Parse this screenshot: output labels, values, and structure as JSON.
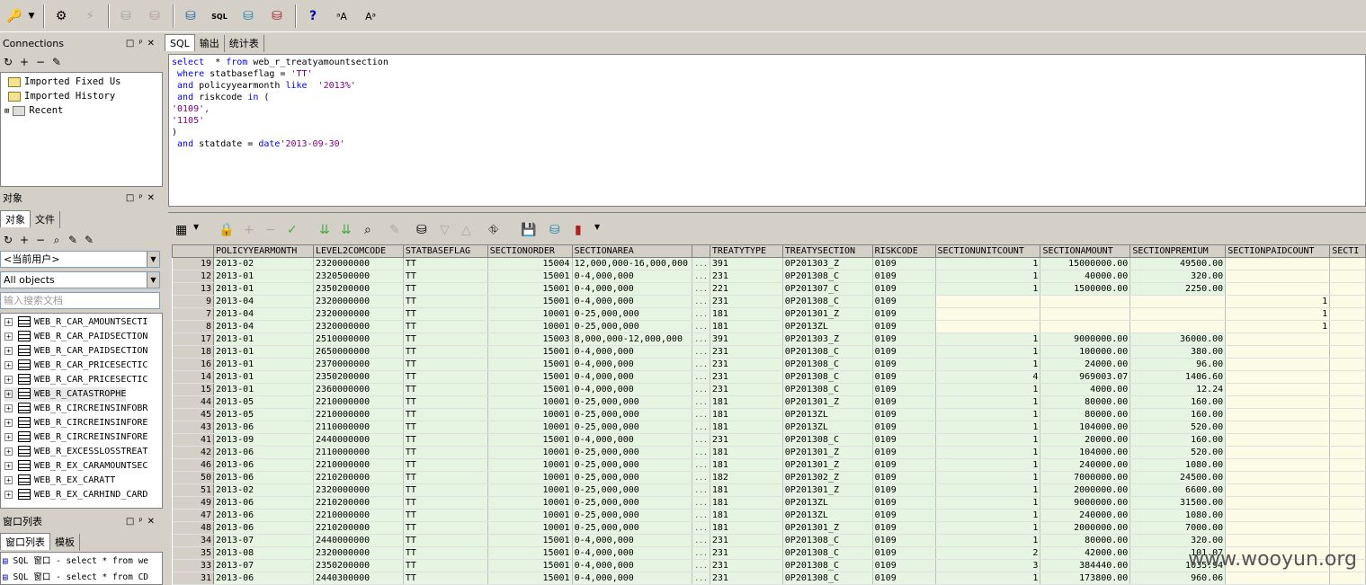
{
  "toolbar": {
    "icons": [
      "key-icon",
      "gear-icon",
      "lightning-icon",
      "commit-icon",
      "rollback-icon",
      "connect-icon",
      "sql-db-icon",
      "db-icon",
      "disconnect-icon",
      "help-icon",
      "font-icon",
      "font2-icon"
    ],
    "sql_label": "SQL"
  },
  "connections": {
    "title": "Connections",
    "items": [
      "Imported Fixed Us",
      "Imported History",
      "Recent"
    ]
  },
  "objects": {
    "title": "对象",
    "tabs": [
      "对象",
      "文件"
    ],
    "user_select": "<当前用户>",
    "type_select": "All objects",
    "search_placeholder": "输入搜索文档",
    "items": [
      "WEB_R_CAR_AMOUNTSECTI",
      "WEB_R_CAR_PAIDSECTION",
      "WEB_R_CAR_PAIDSECTION",
      "WEB_R_CAR_PRICESECTIC",
      "WEB_R_CAR_PRICESECTIC",
      "WEB_R_CATASTROPHE",
      "WEB_R_CIRCREINSINFOBR",
      "WEB_R_CIRCREINSINFORE",
      "WEB_R_CIRCREINSINFORE",
      "WEB_R_EXCESSLOSSTREAT",
      "WEB_R_EX_CARAMOUNTSEC",
      "WEB_R_EX_CARATT",
      "WEB_R_EX_CARHIND_CARD"
    ]
  },
  "windows": {
    "title": "窗口列表",
    "tabs": [
      "窗口列表",
      "模板"
    ],
    "items": [
      "SQL 窗口 - select * from we",
      "SQL 窗口 - select * from CD"
    ]
  },
  "editor": {
    "tabs": [
      "SQL",
      "输出",
      "统计表"
    ],
    "lines": [
      [
        [
          "kw",
          "select"
        ],
        [
          "",
          "  * "
        ],
        [
          "kw",
          "from"
        ],
        [
          "",
          " web_r_treatyamountsection"
        ]
      ],
      [
        [
          "",
          " "
        ],
        [
          "kw",
          "where"
        ],
        [
          "",
          " statbaseflag = "
        ],
        [
          "str",
          "'TT'"
        ]
      ],
      [
        [
          "",
          " "
        ],
        [
          "kw",
          "and"
        ],
        [
          "",
          " policyyearmonth "
        ],
        [
          "kw",
          "like"
        ],
        [
          "",
          "  "
        ],
        [
          "str",
          "'2013%'"
        ]
      ],
      [
        [
          "",
          " "
        ],
        [
          "kw",
          "and"
        ],
        [
          "",
          " riskcode "
        ],
        [
          "kw",
          "in"
        ],
        [
          "",
          " ("
        ]
      ],
      [
        [
          "str",
          "'0109',"
        ]
      ],
      [
        [
          "str",
          "'1105'"
        ]
      ],
      [
        [
          "",
          ")"
        ]
      ],
      [
        [
          "",
          " "
        ],
        [
          "kw",
          "and"
        ],
        [
          "",
          " statdate = "
        ],
        [
          "kw",
          "date"
        ],
        [
          "str",
          "'2013-09-30'"
        ]
      ]
    ]
  },
  "grid": {
    "columns": [
      "",
      "POLICYYEARMONTH",
      "LEVEL2COMCODE",
      "STATBASEFLAG",
      "SECTIONORDER",
      "SECTIONAREA",
      "",
      "TREATYTYPE",
      "TREATYSECTION",
      "RISKCODE",
      "SECTIONUNITCOUNT",
      "SECTIONAMOUNT",
      "SECTIONPREMIUM",
      "SECTIONPAIDCOUNT",
      "SECTI"
    ],
    "rows": [
      [
        "19",
        "2013-02",
        "2320000000",
        "TT",
        "15004",
        "12,000,000-16,000,000",
        "...",
        "391",
        "0P201303_Z",
        "0109",
        "1",
        "15000000.00",
        "49500.00",
        "",
        ""
      ],
      [
        "12",
        "2013-01",
        "2320500000",
        "TT",
        "15001",
        "0-4,000,000",
        "...",
        "231",
        "0P201308_C",
        "0109",
        "1",
        "40000.00",
        "320.00",
        "",
        ""
      ],
      [
        "13",
        "2013-01",
        "2350200000",
        "TT",
        "15001",
        "0-4,000,000",
        "...",
        "221",
        "0P201307_C",
        "0109",
        "1",
        "1500000.00",
        "2250.00",
        "",
        ""
      ],
      [
        "9",
        "2013-04",
        "2320000000",
        "TT",
        "15001",
        "0-4,000,000",
        "...",
        "231",
        "0P201308_C",
        "0109",
        "",
        "",
        "",
        "1",
        ""
      ],
      [
        "7",
        "2013-04",
        "2320000000",
        "TT",
        "10001",
        "0-25,000,000",
        "...",
        "181",
        "0P201301_Z",
        "0109",
        "",
        "",
        "",
        "1",
        ""
      ],
      [
        "8",
        "2013-04",
        "2320000000",
        "TT",
        "10001",
        "0-25,000,000",
        "...",
        "181",
        "0P2013ZL",
        "0109",
        "",
        "",
        "",
        "1",
        ""
      ],
      [
        "17",
        "2013-01",
        "2510000000",
        "TT",
        "15003",
        "8,000,000-12,000,000",
        "...",
        "391",
        "0P201303_Z",
        "0109",
        "1",
        "9000000.00",
        "36000.00",
        "",
        ""
      ],
      [
        "18",
        "2013-01",
        "2650000000",
        "TT",
        "15001",
        "0-4,000,000",
        "...",
        "231",
        "0P201308_C",
        "0109",
        "1",
        "100000.00",
        "380.00",
        "",
        ""
      ],
      [
        "16",
        "2013-01",
        "2370000000",
        "TT",
        "15001",
        "0-4,000,000",
        "...",
        "231",
        "0P201308_C",
        "0109",
        "1",
        "24000.00",
        "96.00",
        "",
        ""
      ],
      [
        "14",
        "2013-01",
        "2350200000",
        "TT",
        "15001",
        "0-4,000,000",
        "...",
        "231",
        "0P201308_C",
        "0109",
        "4",
        "969003.07",
        "1406.60",
        "",
        ""
      ],
      [
        "15",
        "2013-01",
        "2360000000",
        "TT",
        "15001",
        "0-4,000,000",
        "...",
        "231",
        "0P201308_C",
        "0109",
        "1",
        "4000.00",
        "12.24",
        "",
        ""
      ],
      [
        "44",
        "2013-05",
        "2210000000",
        "TT",
        "10001",
        "0-25,000,000",
        "...",
        "181",
        "0P201301_Z",
        "0109",
        "1",
        "80000.00",
        "160.00",
        "",
        ""
      ],
      [
        "45",
        "2013-05",
        "2210000000",
        "TT",
        "10001",
        "0-25,000,000",
        "...",
        "181",
        "0P2013ZL",
        "0109",
        "1",
        "80000.00",
        "160.00",
        "",
        ""
      ],
      [
        "43",
        "2013-06",
        "2110000000",
        "TT",
        "10001",
        "0-25,000,000",
        "...",
        "181",
        "0P2013ZL",
        "0109",
        "1",
        "104000.00",
        "520.00",
        "",
        ""
      ],
      [
        "41",
        "2013-09",
        "2440000000",
        "TT",
        "15001",
        "0-4,000,000",
        "...",
        "231",
        "0P201308_C",
        "0109",
        "1",
        "20000.00",
        "160.00",
        "",
        ""
      ],
      [
        "42",
        "2013-06",
        "2110000000",
        "TT",
        "10001",
        "0-25,000,000",
        "...",
        "181",
        "0P201301_Z",
        "0109",
        "1",
        "104000.00",
        "520.00",
        "",
        ""
      ],
      [
        "46",
        "2013-06",
        "2210000000",
        "TT",
        "10001",
        "0-25,000,000",
        "...",
        "181",
        "0P201301_Z",
        "0109",
        "1",
        "240000.00",
        "1080.00",
        "",
        ""
      ],
      [
        "50",
        "2013-06",
        "2210200000",
        "TT",
        "10001",
        "0-25,000,000",
        "...",
        "182",
        "0P201302_Z",
        "0109",
        "1",
        "7000000.00",
        "24500.00",
        "",
        ""
      ],
      [
        "51",
        "2013-02",
        "2320000000",
        "TT",
        "10001",
        "0-25,000,000",
        "...",
        "181",
        "0P201301_Z",
        "0109",
        "1",
        "2000000.00",
        "6600.00",
        "",
        ""
      ],
      [
        "49",
        "2013-06",
        "2210200000",
        "TT",
        "10001",
        "0-25,000,000",
        "...",
        "181",
        "0P2013ZL",
        "0109",
        "1",
        "9000000.00",
        "31500.00",
        "",
        ""
      ],
      [
        "47",
        "2013-06",
        "2210000000",
        "TT",
        "10001",
        "0-25,000,000",
        "...",
        "181",
        "0P2013ZL",
        "0109",
        "1",
        "240000.00",
        "1080.00",
        "",
        ""
      ],
      [
        "48",
        "2013-06",
        "2210200000",
        "TT",
        "10001",
        "0-25,000,000",
        "...",
        "181",
        "0P201301_Z",
        "0109",
        "1",
        "2000000.00",
        "7000.00",
        "",
        ""
      ],
      [
        "34",
        "2013-07",
        "2440000000",
        "TT",
        "15001",
        "0-4,000,000",
        "...",
        "231",
        "0P201308_C",
        "0109",
        "1",
        "80000.00",
        "320.00",
        "",
        ""
      ],
      [
        "35",
        "2013-08",
        "2320000000",
        "TT",
        "15001",
        "0-4,000,000",
        "...",
        "231",
        "0P201308_C",
        "0109",
        "2",
        "42000.00",
        "101.07",
        "",
        ""
      ],
      [
        "33",
        "2013-07",
        "2350200000",
        "TT",
        "15001",
        "0-4,000,000",
        "...",
        "231",
        "0P201308_C",
        "0109",
        "3",
        "384440.00",
        "1035.94",
        "",
        ""
      ],
      [
        "31",
        "2013-06",
        "2440300000",
        "TT",
        "15001",
        "0-4,000,000",
        "...",
        "231",
        "0P201308_C",
        "0109",
        "1",
        "173800.00",
        "960.06",
        "",
        ""
      ]
    ]
  },
  "watermark": "www.wooyun.org"
}
